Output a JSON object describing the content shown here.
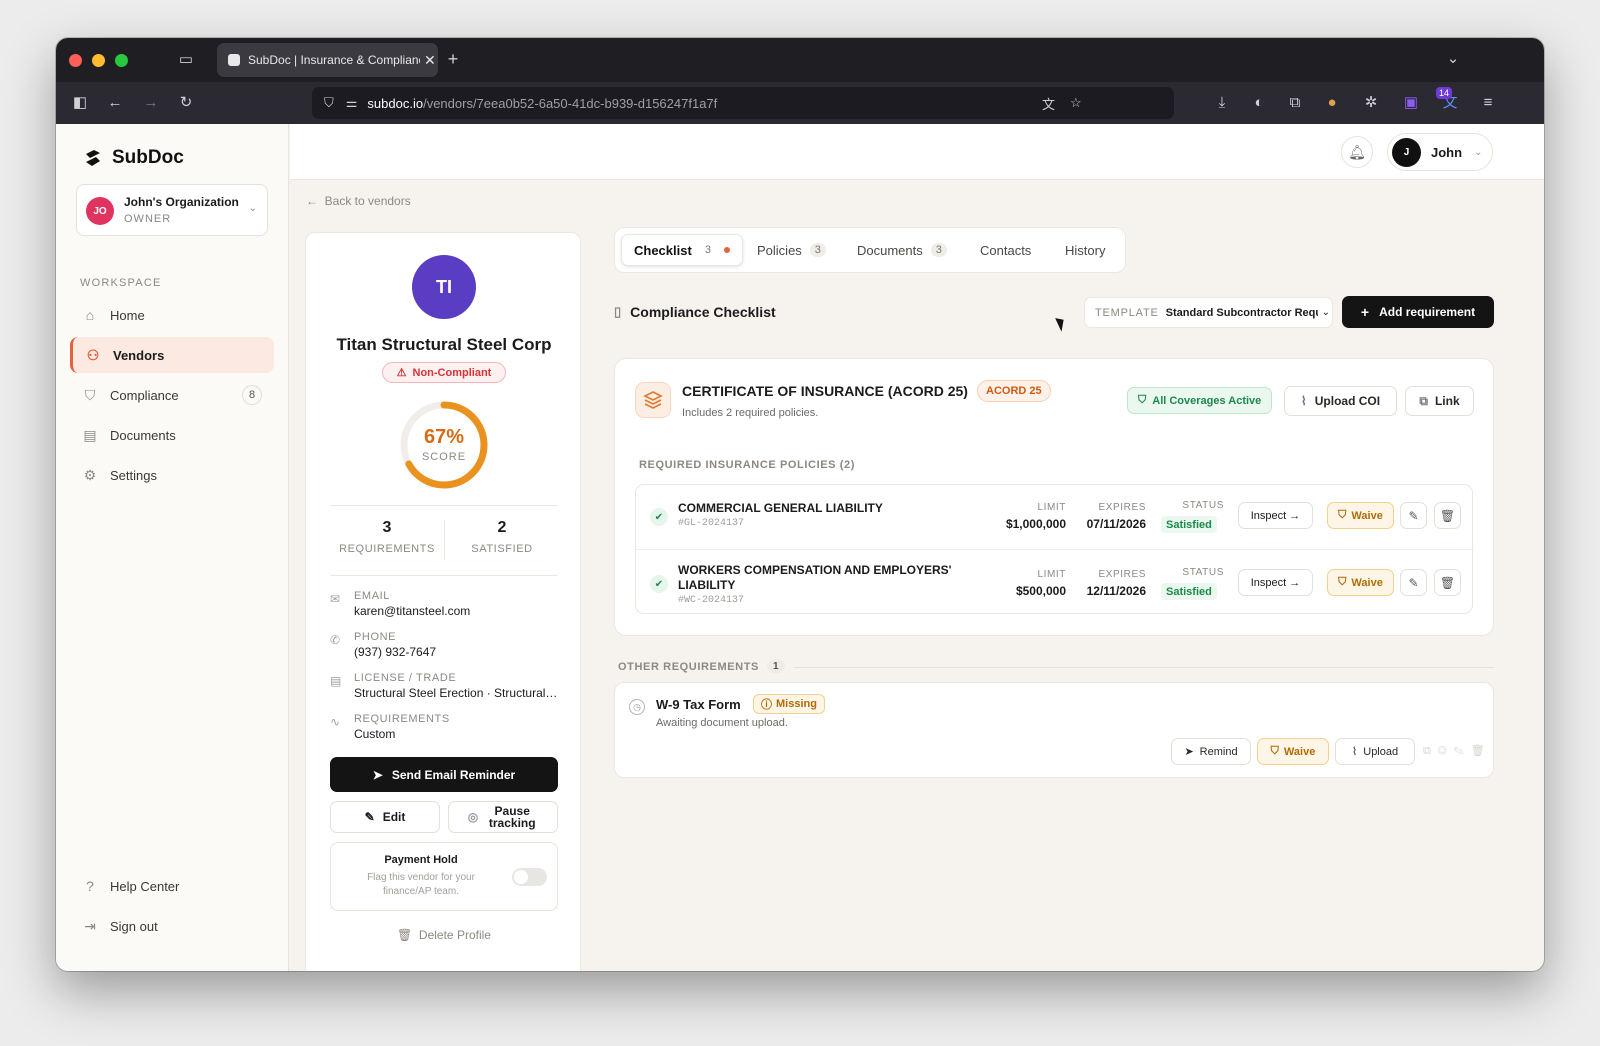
{
  "browser": {
    "tab_title": "SubDoc | Insurance & Compliance",
    "url_host": "subdoc.io",
    "url_path": "/vendors/7eea0b52-6a50-41dc-b939-d156247f1a7f",
    "extension_badge": "14"
  },
  "sidebar": {
    "brand": "SubDoc",
    "org": {
      "initials": "JO",
      "name": "John's Organization",
      "role": "OWNER"
    },
    "section_label": "WORKSPACE",
    "items": [
      {
        "label": "Home",
        "icon": "home-icon"
      },
      {
        "label": "Vendors",
        "icon": "users-icon",
        "active": true
      },
      {
        "label": "Compliance",
        "icon": "shield-icon",
        "count": "8"
      },
      {
        "label": "Documents",
        "icon": "document-icon"
      },
      {
        "label": "Settings",
        "icon": "gear-icon"
      }
    ],
    "help": "Help Center",
    "signout": "Sign out"
  },
  "topbar": {
    "user_initial": "J",
    "user_name": "John"
  },
  "back_link": "Back to vendors",
  "vendor": {
    "initials": "TI",
    "name": "Titan Structural Steel Corp",
    "status": "Non-Compliant",
    "score": 67,
    "score_text": "67%",
    "score_label": "SCORE",
    "requirements_count": "3",
    "requirements_label": "REQUIREMENTS",
    "satisfied_count": "2",
    "satisfied_label": "SATISFIED",
    "email_label": "EMAIL",
    "email": "karen@titansteel.com",
    "phone_label": "PHONE",
    "phone": "(937) 932-7647",
    "license_label": "LICENSE / TRADE",
    "license": "Structural Steel Erection · Structural Steel",
    "req_label": "REQUIREMENTS",
    "req_value": "Custom",
    "send_reminder": "Send Email Reminder",
    "edit": "Edit",
    "pause_tracking": "Pause tracking",
    "payment_hold_title": "Payment Hold",
    "payment_hold_desc": "Flag this vendor for your finance/AP team.",
    "payment_hold_on": false,
    "delete_profile": "Delete Profile"
  },
  "tabs": [
    {
      "label": "Checklist",
      "count": "3",
      "active": true,
      "dot": true
    },
    {
      "label": "Policies",
      "count": "3"
    },
    {
      "label": "Documents",
      "count": "3"
    },
    {
      "label": "Contacts"
    },
    {
      "label": "History"
    }
  ],
  "checklist": {
    "title": "Compliance Checklist",
    "template_label": "TEMPLATE",
    "template_value": "Standard Subcontractor Requirements",
    "add_requirement": "Add requirement"
  },
  "coi": {
    "title": "CERTIFICATE OF INSURANCE (ACORD 25)",
    "tag": "ACORD 25",
    "subtitle": "Includes 2 required policies.",
    "status": "All Coverages Active",
    "upload": "Upload COI",
    "link": "Link",
    "policies_label": "REQUIRED INSURANCE POLICIES (2)",
    "col_limit": "LIMIT",
    "col_expires": "EXPIRES",
    "col_status": "STATUS",
    "inspect": "Inspect →",
    "waive": "Waive",
    "policies": [
      {
        "name": "COMMERCIAL GENERAL LIABILITY",
        "number": "#GL-2024137",
        "limit": "$1,000,000",
        "expires": "07/11/2026",
        "status": "Satisfied"
      },
      {
        "name": "WORKERS COMPENSATION AND EMPLOYERS' LIABILITY",
        "number": "#WC-2024137",
        "limit": "$500,000",
        "expires": "12/11/2026",
        "status": "Satisfied"
      }
    ]
  },
  "other": {
    "label": "OTHER REQUIREMENTS",
    "count": "1",
    "w9_title": "W-9 Tax Form",
    "w9_status": "Missing",
    "w9_subtitle": "Awaiting document upload.",
    "remind": "Remind",
    "waive": "Waive",
    "upload": "Upload"
  },
  "colors": {
    "accent": "#e2643b",
    "success": "#1b8a4a",
    "danger": "#d83434",
    "warning": "#b16b07",
    "score": "#d96a15"
  }
}
